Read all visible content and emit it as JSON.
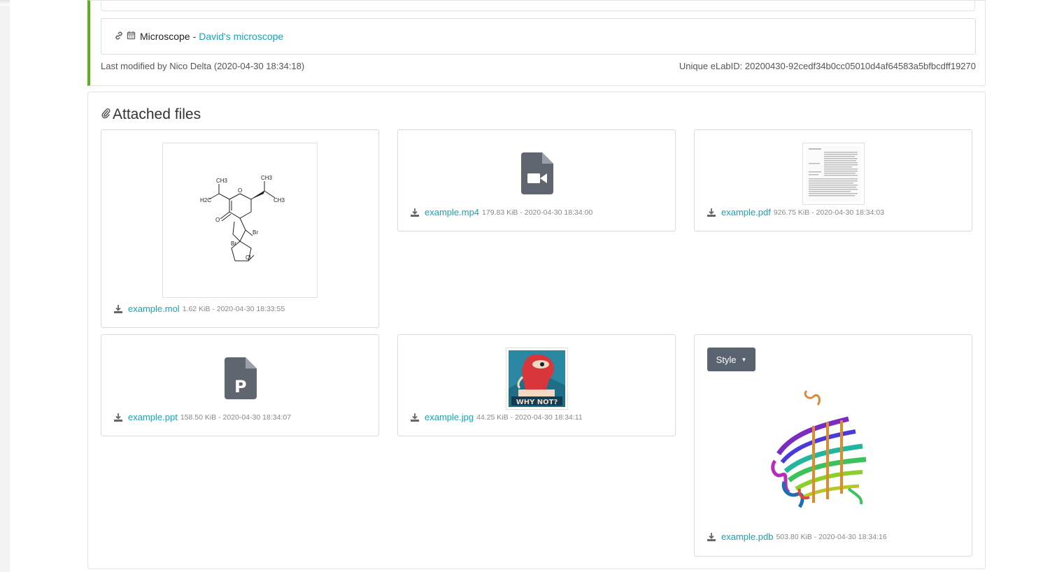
{
  "experiment": {
    "link_category": "Microscope",
    "link_separator": "-",
    "link_title": "David's microscope",
    "last_modified": "Last modified by Nico Delta (2020-04-30 18:34:18)",
    "unique_id": "Unique eLabID: 20200430-92cedf34b0cc05010d4af64583a5bfbcdff19270"
  },
  "attachments": {
    "title": "Attached files",
    "files": [
      {
        "name": "example.mol",
        "meta": "1.62 KiB - 2020-04-30 18:33:55",
        "icon": "molecule-preview"
      },
      {
        "name": "example.mp4",
        "meta": "179.83 KiB - 2020-04-30 18:34:00",
        "icon": "video-file-icon"
      },
      {
        "name": "example.pdf",
        "meta": "926.75 KiB - 2020-04-30 18:34:03",
        "icon": "pdf-thumbnail"
      },
      {
        "name": "example.ppt",
        "meta": "158.50 KiB - 2020-04-30 18:34:07",
        "icon": "powerpoint-file-icon"
      },
      {
        "name": "example.jpg",
        "meta": "44.25 KiB - 2020-04-30 18:34:11",
        "icon": "image-thumbnail"
      },
      {
        "name": "example.pdb",
        "meta": "503.80 KiB - 2020-04-30 18:34:16",
        "icon": "protein-3d-viewer"
      }
    ],
    "style_button": "Style",
    "jpg_caption": "WHY NOT?",
    "molecule_labels": {
      "ch3": "CH3",
      "h2c": "H2C",
      "o": "O",
      "br": "Br",
      "cl": "Cl"
    }
  },
  "colors": {
    "accent": "#17a2b8",
    "status_bar": "#5cb01e",
    "button": "#5a6470"
  }
}
